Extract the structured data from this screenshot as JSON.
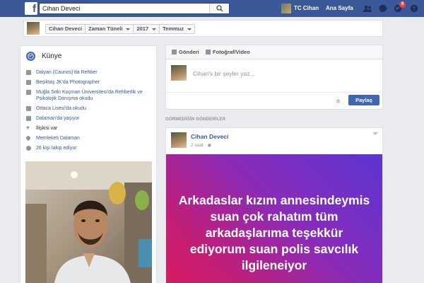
{
  "topbar": {
    "search_value": "Cihan Deveci",
    "profile_name": "TC Cihan",
    "home_label": "Ana Sayfa",
    "notification_count": "9",
    "brand_color": "#3b5998"
  },
  "timeline_nav": {
    "crumbs": [
      "Cihan Deveci",
      "Zaman Tüneli",
      "2017",
      "Temmuz"
    ]
  },
  "intro": {
    "title": "Künye",
    "items": [
      {
        "text": "Dalyan (Caunos)'da Rehber",
        "icon": "briefcase-icon"
      },
      {
        "text": "Beşiktaş JK'da Photographer",
        "icon": "briefcase-icon"
      },
      {
        "text": "Muğla Sıtkı Koçman Üniversitesi'da Rehberlik ve Psikolojik Danışma okudu",
        "icon": "graduation-icon"
      },
      {
        "text": "Ortaca Lisesi'da okudu",
        "icon": "graduation-icon"
      },
      {
        "text": "Dalaman'da yaşıyor",
        "icon": "home-icon"
      },
      {
        "text": "İlişkisi var",
        "icon": "heart-icon"
      },
      {
        "text": "Memleketi Dalaman",
        "icon": "location-pin-icon"
      },
      {
        "text": "26 kişi takip ediyor",
        "icon": "followers-icon"
      }
    ]
  },
  "composer": {
    "tab_post": "Gönderi",
    "tab_photo": "Fotoğraf/Video",
    "placeholder": "Cihan's bir şeyler yaz...",
    "share_label": "Paylaş"
  },
  "section_label": "GÖRMEDİĞİN GÖNDERİLER",
  "post": {
    "author": "Cihan Deveci",
    "time": "2 saat · ",
    "text": "Arkadaslar kızım annesindeymis suan çok rahatım tüm arkadaşlarıma teşekkür ediyorum suan polis savcılık ilgileneiyor",
    "gradient_start": "#5c35d1",
    "gradient_end": "#d81b60"
  }
}
